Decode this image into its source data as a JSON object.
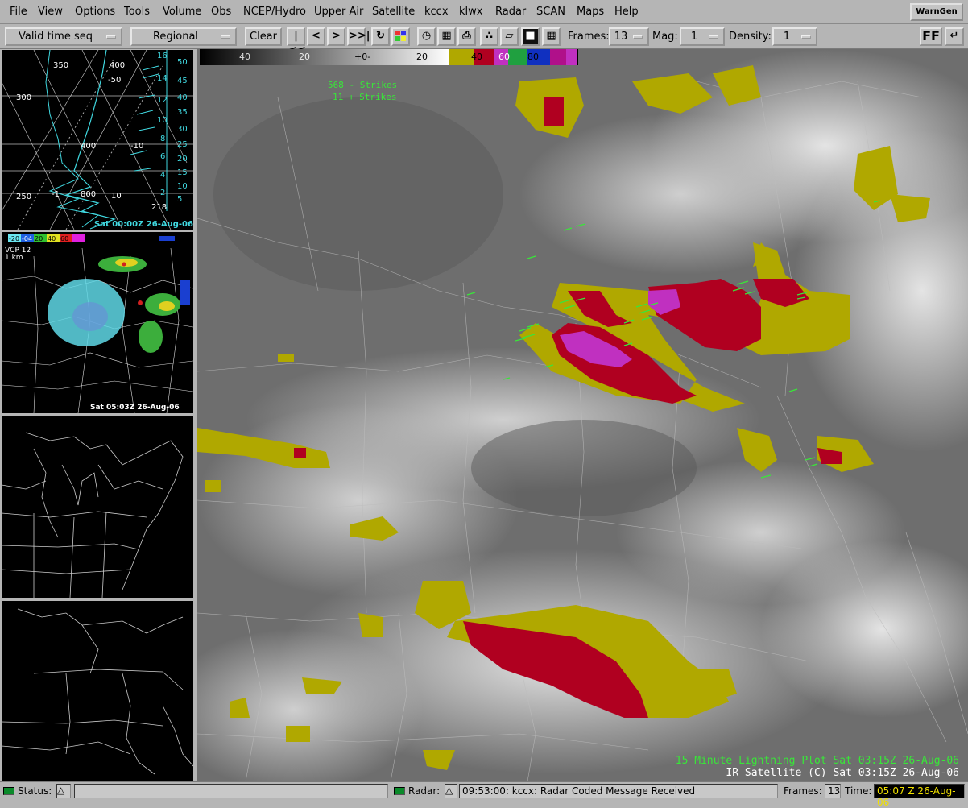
{
  "menu": [
    "File",
    "View",
    "Options",
    "Tools",
    "Volume",
    "Obs",
    "NCEP/Hydro",
    "Upper Air",
    "Satellite",
    "kccx",
    "klwx",
    "Radar",
    "SCAN",
    "Maps",
    "Help"
  ],
  "warngen_label": "WarnGen",
  "toolbar": {
    "time_mode": "Valid time seq",
    "scale": "Regional",
    "clear": "Clear",
    "frames_label": "Frames:",
    "frames_value": "13",
    "mag_label": "Mag:",
    "mag_value": "1",
    "density_label": "Density:",
    "density_value": "1",
    "ff_label": "FF"
  },
  "panes": {
    "skewt_time": "Sat 00:00Z 26-Aug-06",
    "skewt_press": [
      "300",
      "400",
      "-50",
      "800",
      "250",
      "350",
      "400"
    ],
    "skewt_right_axis": [
      "16",
      "14",
      "12",
      "10",
      "8",
      "6",
      "4",
      "2"
    ],
    "skewt_right_axis2": [
      "50",
      "45",
      "40",
      "35",
      "30",
      "25",
      "20",
      "15",
      "10",
      "5"
    ],
    "skewt_misc": [
      "218",
      "10",
      "-10",
      "-1"
    ],
    "radar_header": "VCP 12",
    "radar_res": "1 km",
    "radar_scale": [
      "-20",
      "-04",
      "20",
      "40",
      "60"
    ],
    "radar_time": "Sat 05:03Z 26-Aug-06"
  },
  "main": {
    "colorbar_labels": [
      "40",
      "20",
      "+0-",
      "20",
      "40",
      "60",
      "80"
    ],
    "strikes1": "568 - Strikes",
    "strikes2": "11 + Strikes",
    "legend_lightning": "15 Minute Lightning Plot  Sat 03:15Z 26-Aug-06",
    "legend_ir": "IR Satellite (C)  Sat 03:15Z 26-Aug-06"
  },
  "status": {
    "status_label": "Status:",
    "radar_label": "Radar:",
    "radar_msg": "09:53:00: kccx: Radar Coded Message Received",
    "frames_label": "Frames:",
    "frames_value": "13",
    "time_label": "Time:",
    "time_value": "05:07 Z 26-Aug-06"
  },
  "colors": {
    "lightning_green": "#39e639",
    "ir_white": "#ffffff",
    "storm_red": "#b00020",
    "storm_magenta": "#c030c0",
    "storm_yellow": "#b0a800",
    "sounding_cyan": "#40d8e0",
    "time_highlight": "#f0e000"
  }
}
